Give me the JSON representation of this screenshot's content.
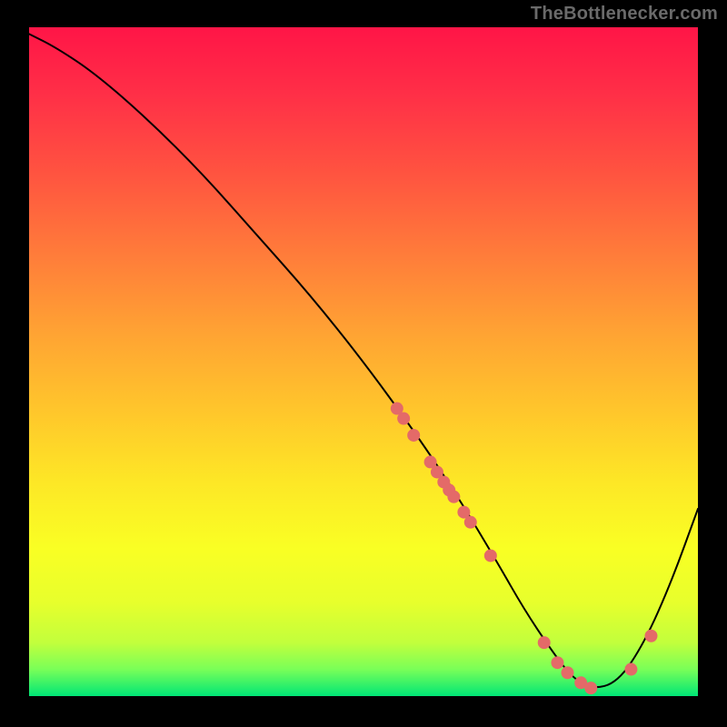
{
  "attribution": "TheBottlenecker.com",
  "chart_data": {
    "type": "line",
    "title": "",
    "xlabel": "",
    "ylabel": "",
    "xlim": [
      0,
      100
    ],
    "ylim": [
      0,
      100
    ],
    "series": [
      {
        "name": "bottleneck-curve",
        "x": [
          0,
          4,
          10,
          18,
          26,
          34,
          42,
          50,
          58,
          64,
          70,
          74,
          78,
          81,
          84,
          88,
          92,
          96,
          100
        ],
        "y": [
          99,
          97,
          93,
          86,
          78,
          69,
          60,
          50,
          39,
          30,
          20,
          13,
          7,
          3,
          1,
          2,
          8,
          17,
          28
        ]
      }
    ],
    "markers": {
      "name": "highlighted-points",
      "points": [
        {
          "x": 55,
          "y": 43
        },
        {
          "x": 56,
          "y": 41.5
        },
        {
          "x": 57.5,
          "y": 39
        },
        {
          "x": 60,
          "y": 35
        },
        {
          "x": 61,
          "y": 33.5
        },
        {
          "x": 62,
          "y": 32
        },
        {
          "x": 62.8,
          "y": 30.8
        },
        {
          "x": 63.5,
          "y": 29.8
        },
        {
          "x": 65,
          "y": 27.5
        },
        {
          "x": 66,
          "y": 26
        },
        {
          "x": 69,
          "y": 21
        },
        {
          "x": 77,
          "y": 8
        },
        {
          "x": 79,
          "y": 5
        },
        {
          "x": 80.5,
          "y": 3.5
        },
        {
          "x": 82.5,
          "y": 2
        },
        {
          "x": 84,
          "y": 1.2
        },
        {
          "x": 90,
          "y": 4
        },
        {
          "x": 93,
          "y": 9
        }
      ]
    }
  }
}
